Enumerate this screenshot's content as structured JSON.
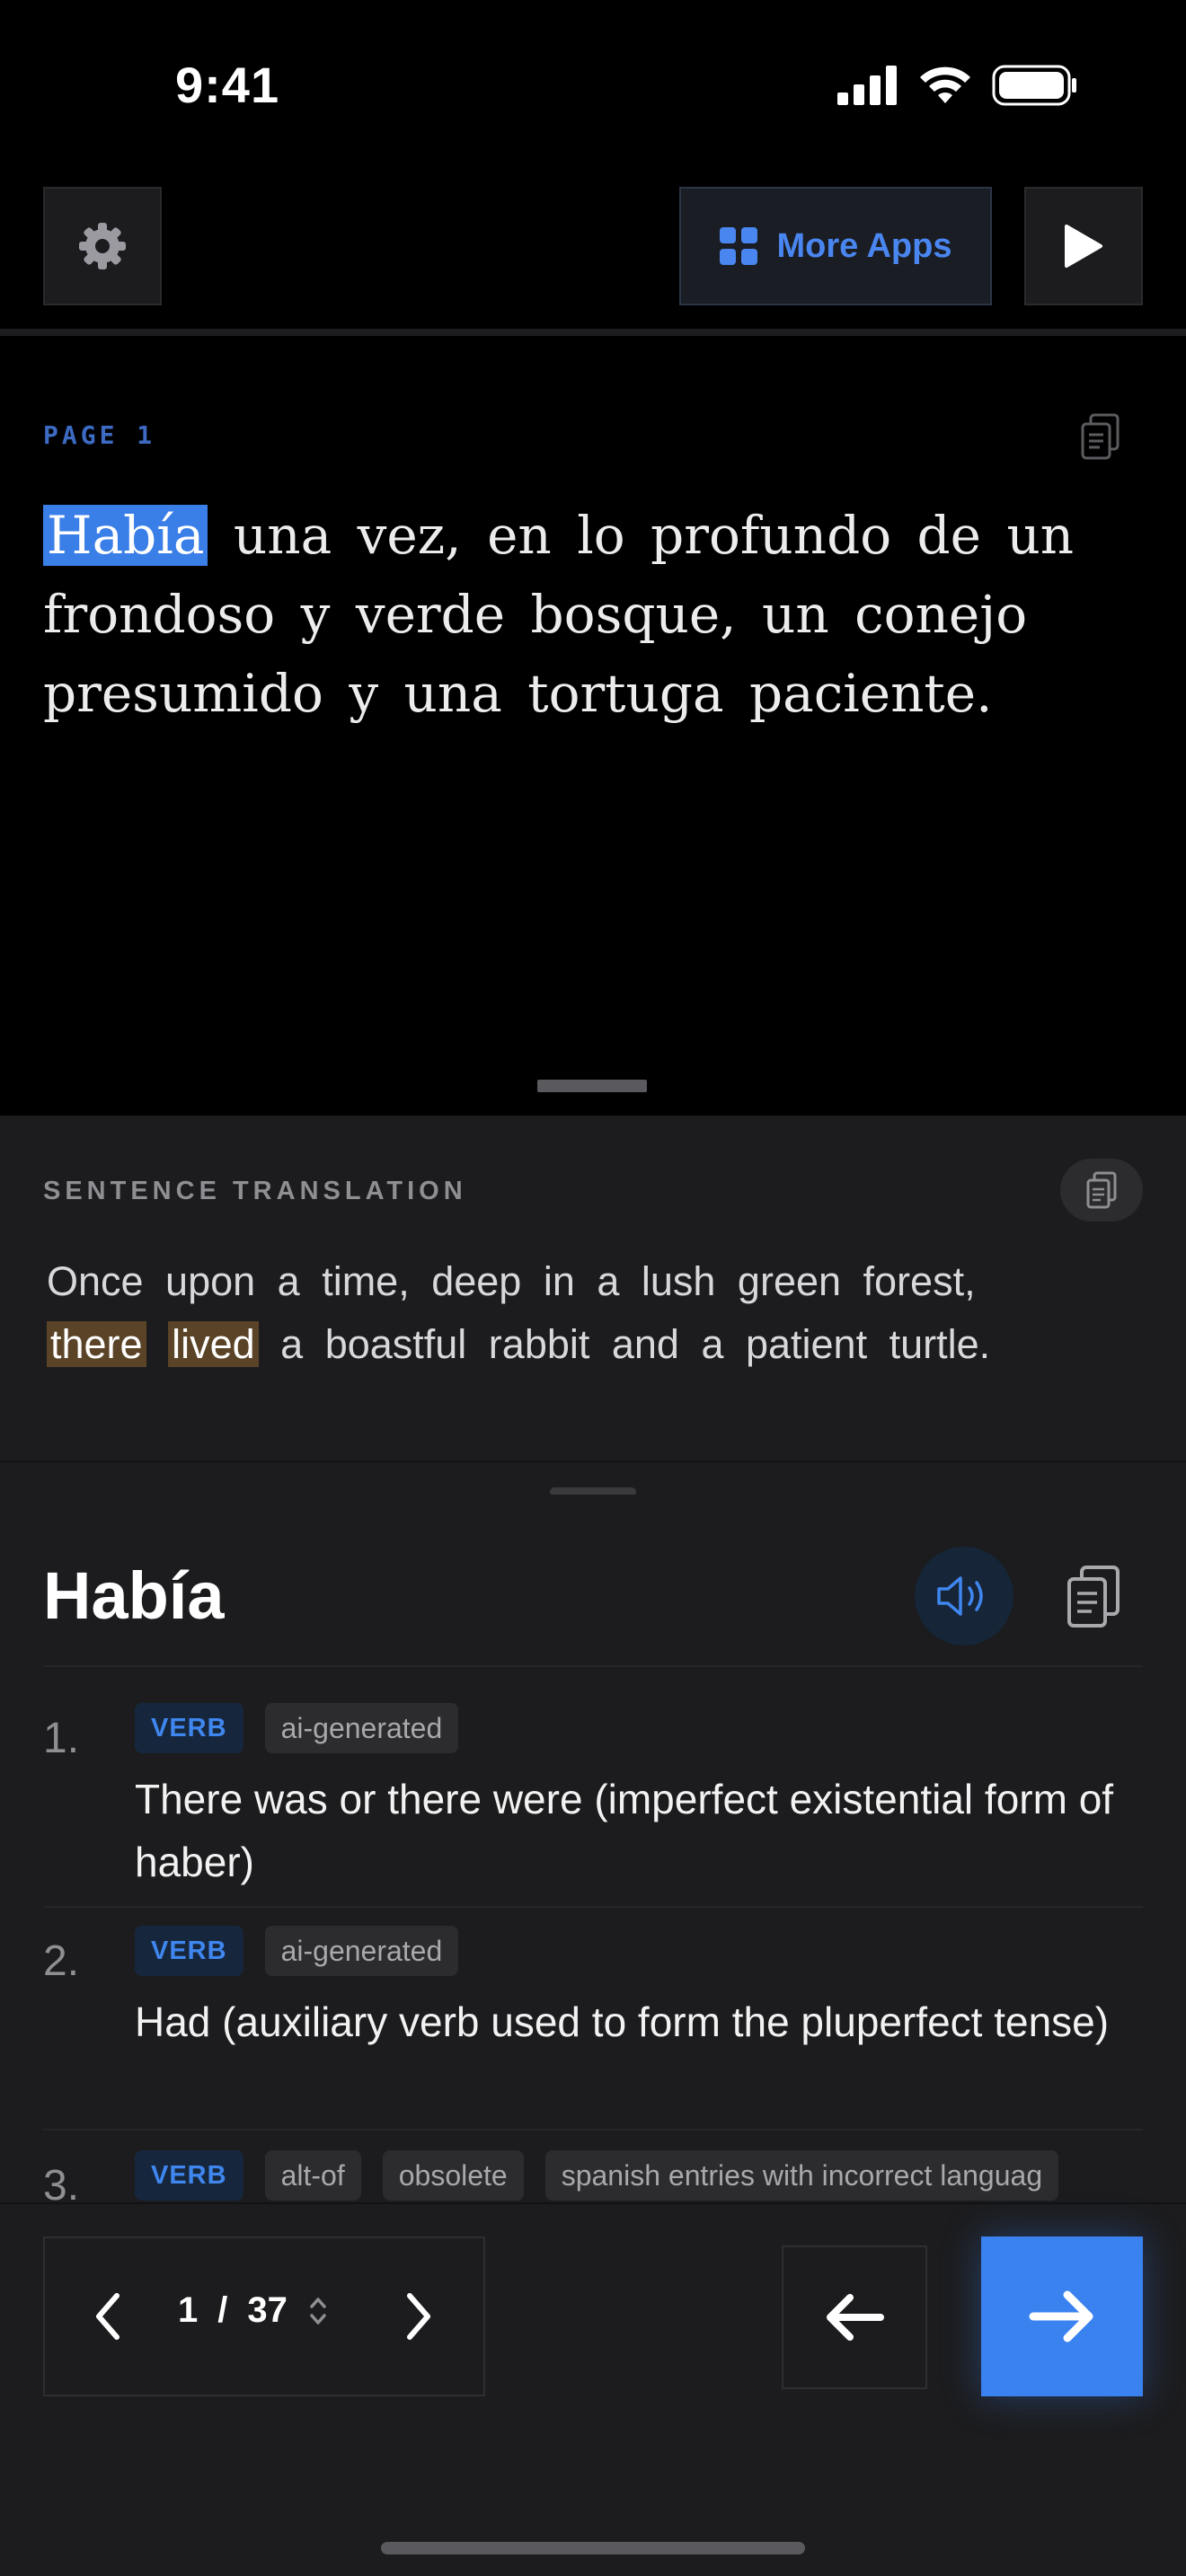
{
  "status_bar": {
    "time": "9:41"
  },
  "toolbar": {
    "more_apps_label": "More Apps"
  },
  "reader": {
    "page_label": "PAGE 1",
    "highlighted_word": "Había",
    "story_rest": " una vez, en lo profundo de un frondoso y verde bosque, un conejo presumido y una tortuga paciente."
  },
  "translation": {
    "label": "SENTENCE TRANSLATION",
    "text_before": "Once upon a time, deep in a lush green forest,",
    "hl1": "there",
    "hl2": "lived",
    "text_after": " a boastful rabbit and a patient turtle."
  },
  "dictionary": {
    "word": "Había",
    "definitions": [
      {
        "num": "1.",
        "tags": [
          "VERB",
          "ai-generated"
        ],
        "text": "There was or there were (imperfect existential form of haber)"
      },
      {
        "num": "2.",
        "tags": [
          "VERB",
          "ai-generated"
        ],
        "text": "Had (auxiliary verb used to form the pluperfect tense)"
      },
      {
        "num": "3.",
        "tags": [
          "VERB",
          "alt-of",
          "obsolete",
          "spanish entries with incorrect languag"
        ]
      }
    ]
  },
  "pager": {
    "current": "1",
    "separator": "/",
    "total": "37"
  },
  "colors": {
    "accent": "#3a82f0",
    "highlight_orange": "#5a4326"
  }
}
